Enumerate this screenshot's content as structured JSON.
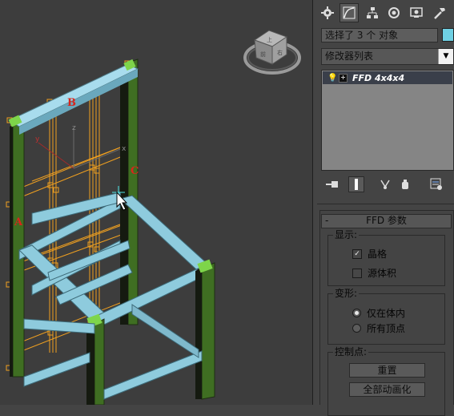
{
  "viewport": {
    "labels": {
      "a": "A",
      "b": "B",
      "c": "C"
    },
    "gizmo_axes": {
      "x": "x",
      "y": "y",
      "z": "z"
    },
    "viewcube_icon": "viewcube-icon",
    "colors": {
      "frame": "#8ecbdd",
      "legs": "#3f6e22",
      "lattice": "#f0a020",
      "corner_cap": "#7ed54a"
    }
  },
  "command_panel": {
    "tabs": [
      {
        "icon": "gear-sphere-icon"
      },
      {
        "icon": "curve-edit-icon",
        "active": true
      },
      {
        "icon": "hierarchy-icon"
      },
      {
        "icon": "motion-icon"
      },
      {
        "icon": "display-icon"
      },
      {
        "icon": "utilities-hammer-icon"
      }
    ],
    "selection_text": "选择了 3 个 对象",
    "object_color": "#6fd0e3",
    "modifier_list": "修改器列表",
    "stack": [
      {
        "label": "FFD 4x4x4",
        "selected": true
      }
    ],
    "stack_tools": [
      {
        "icon": "pin-stack-icon"
      },
      {
        "icon": "show-end-result-icon"
      },
      {
        "icon": "make-unique-icon"
      },
      {
        "icon": "remove-modifier-icon"
      },
      {
        "icon": "configure-modifier-sets-icon"
      }
    ],
    "rollout": {
      "collapse": "-",
      "title": "FFD 参数",
      "display": {
        "label": "显示:",
        "lattice": {
          "label": "晶格",
          "checked": true
        },
        "source_volume": {
          "label": "源体积",
          "checked": false
        }
      },
      "deform": {
        "label": "变形:",
        "inside_volume": {
          "label": "仅在体内",
          "selected": true
        },
        "all_vertices": {
          "label": "所有顶点",
          "selected": false
        }
      },
      "control_points": {
        "label": "控制点:",
        "reset": "重置",
        "animate_all": "全部动画化"
      }
    }
  }
}
